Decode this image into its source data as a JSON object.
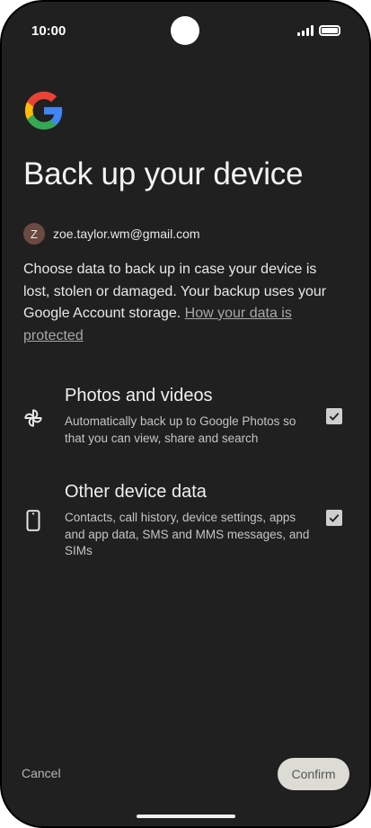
{
  "status_bar": {
    "time": "10:00"
  },
  "page": {
    "title": "Back up your device",
    "account": {
      "initial": "Z",
      "email": "zoe.taylor.wm@gmail.com"
    },
    "description": "Choose data to back up in case your device is lost, stolen or damaged. Your backup uses your Google Account storage. ",
    "link_text": "How your data is protected"
  },
  "options": [
    {
      "icon": "pinwheel-icon",
      "title": "Photos and videos",
      "subtitle": "Automatically back up to Google Photos so that you can view, share and search",
      "checked": true
    },
    {
      "icon": "phone-icon",
      "title": "Other device data",
      "subtitle": "Contacts, call history, device settings, apps and app data, SMS and MMS messages, and SIMs",
      "checked": true
    }
  ],
  "footer": {
    "cancel_label": "Cancel",
    "confirm_label": "Confirm"
  },
  "colors": {
    "background": "#202020",
    "avatar": "#6b4a42",
    "checkbox": "#cfcfcf",
    "confirm_button": "#dcdcd4"
  }
}
